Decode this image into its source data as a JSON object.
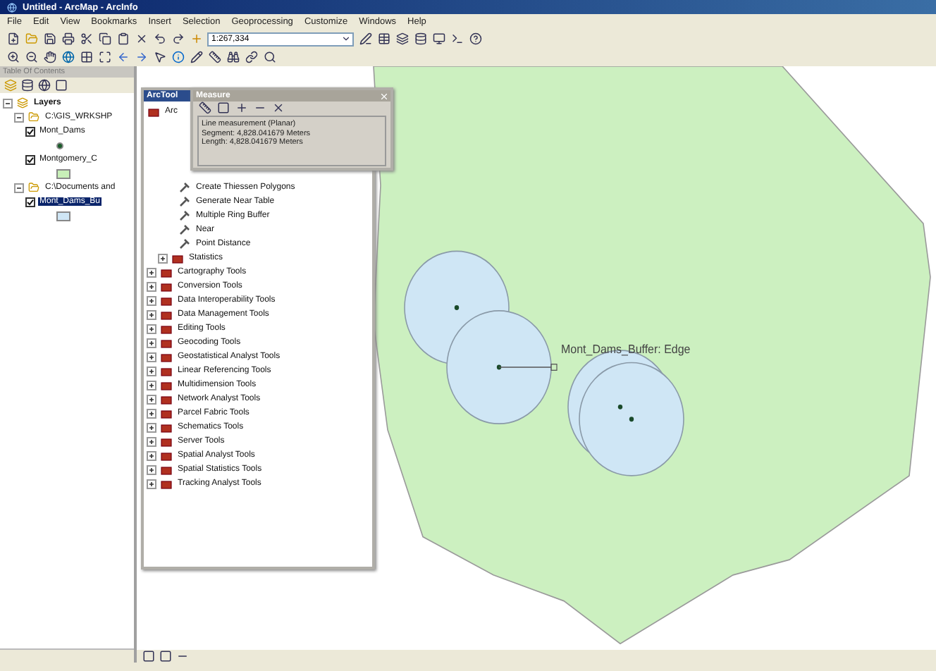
{
  "window": {
    "title": "Untitled - ArcMap - ArcInfo"
  },
  "menu": [
    "File",
    "Edit",
    "View",
    "Bookmarks",
    "Insert",
    "Selection",
    "Geoprocessing",
    "Customize",
    "Windows",
    "Help"
  ],
  "toolbar": {
    "scale": "1:267,334"
  },
  "toc": {
    "title": "Table Of Contents",
    "tree": [
      {
        "label": "Layers",
        "kind": "frame",
        "expanded": true,
        "children": [
          {
            "label": "C:\\GIS_WRKSHP",
            "kind": "folder",
            "expanded": true,
            "children": [
              {
                "label": "Mont_Dams",
                "kind": "point_layer",
                "checked": true,
                "selected": false,
                "color": "#1a5c2a"
              },
              {
                "label": "Montgomery_C",
                "kind": "polygon_layer",
                "checked": true,
                "selected": false,
                "color": "#c8f0b8"
              }
            ]
          },
          {
            "label": "C:\\Documents and",
            "kind": "folder",
            "expanded": true,
            "children": [
              {
                "label": "Mont_Dams_Bu",
                "kind": "polygon_layer",
                "checked": true,
                "selected": true,
                "color": "#cfe6f5"
              }
            ]
          }
        ]
      }
    ]
  },
  "toolbox": {
    "title": "ArcTool",
    "root": "Arc",
    "tools": [
      "Create Thiessen Polygons",
      "Generate Near Table",
      "Multiple Ring Buffer",
      "Near",
      "Point Distance"
    ],
    "toolsets": [
      "Statistics"
    ],
    "toolboxes": [
      "Cartography Tools",
      "Conversion Tools",
      "Data Interoperability Tools",
      "Data Management Tools",
      "Editing Tools",
      "Geocoding Tools",
      "Geostatistical Analyst Tools",
      "Linear Referencing Tools",
      "Multidimension Tools",
      "Network Analyst Tools",
      "Parcel Fabric Tools",
      "Schematics Tools",
      "Server Tools",
      "Spatial Analyst Tools",
      "Spatial Statistics Tools",
      "Tracking Analyst Tools"
    ]
  },
  "measure": {
    "title": "Measure",
    "lines": [
      "Line measurement (Planar)",
      "Segment: 4,828.041679 Meters",
      "Length: 4,828.041679 Meters"
    ]
  },
  "map": {
    "label": "Mont_Dams_Buffer: Edge"
  }
}
